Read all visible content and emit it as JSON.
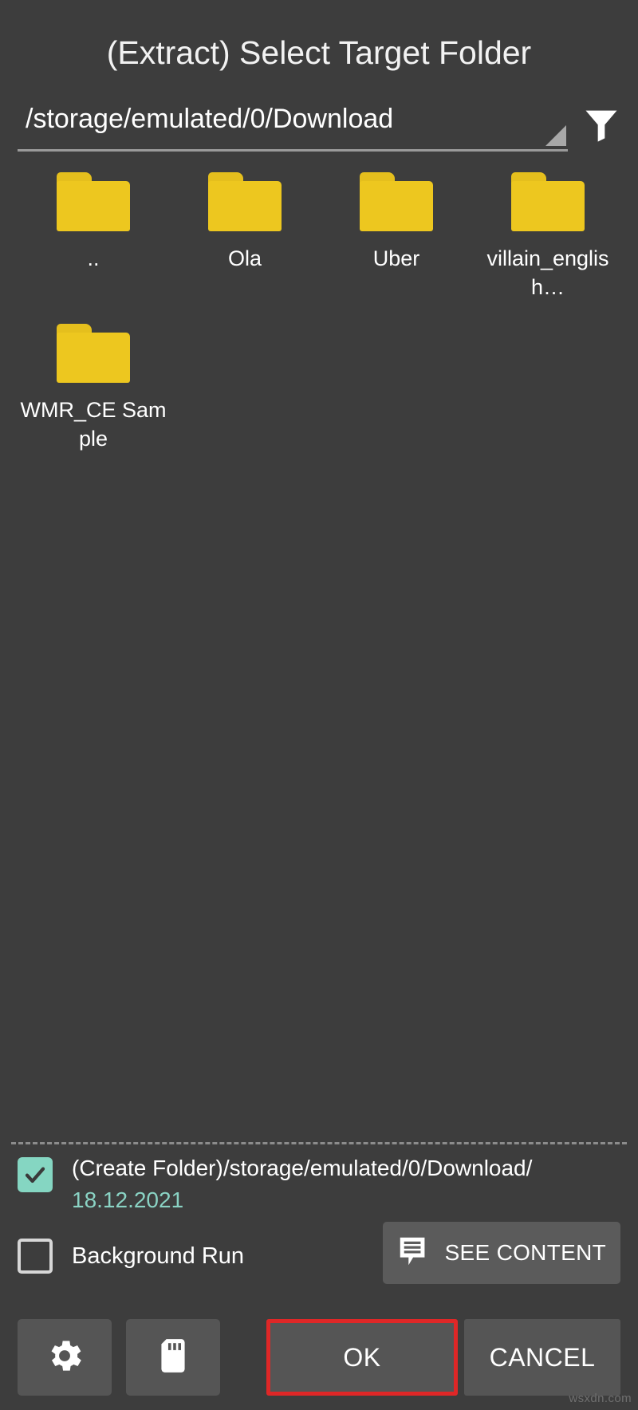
{
  "dialog": {
    "title": "(Extract) Select Target Folder"
  },
  "path_field": {
    "value": "/storage/emulated/0/Download",
    "spinner_icon": "dropdown-triangle-icon",
    "filter_icon": "filter-funnel-icon"
  },
  "folders": [
    {
      "label": "..",
      "icon": "folder-icon"
    },
    {
      "label": "Ola",
      "icon": "folder-icon"
    },
    {
      "label": "Uber",
      "icon": "folder-icon"
    },
    {
      "label": "villain_english…",
      "icon": "folder-icon"
    },
    {
      "label": "WMR_CE Sample",
      "icon": "folder-icon"
    }
  ],
  "options": {
    "create_folder": {
      "checked": true,
      "line1": "(Create Folder)/storage/emulated/0/Download/",
      "line2": "18.12.2021"
    },
    "background_run": {
      "checked": false,
      "label": "Background Run"
    },
    "see_content": {
      "label": "SEE CONTENT",
      "icon": "comment-lines-icon"
    }
  },
  "actions": {
    "settings": {
      "icon": "gear-icon"
    },
    "sdcard": {
      "icon": "sd-card-icon"
    },
    "ok": {
      "label": "OK",
      "highlight_color": "#df2727"
    },
    "cancel": {
      "label": "CANCEL"
    }
  },
  "watermark": "wsxdn.com",
  "colors": {
    "background": "#3d3d3d",
    "folder": "#edc71f",
    "accent_teal": "#85d6c2",
    "button": "#555555",
    "highlight_red": "#df2727"
  }
}
